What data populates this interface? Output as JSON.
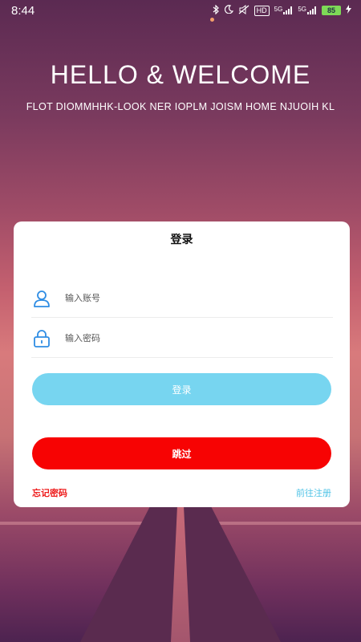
{
  "status_bar": {
    "time": "8:44",
    "hd": "HD",
    "net1": "5G",
    "net2": "5G",
    "battery": "85",
    "icons": [
      "bluetooth-icon",
      "moon-icon",
      "mute-icon",
      "hd-icon",
      "signal-icon",
      "signal-icon",
      "battery-icon",
      "charging-icon"
    ]
  },
  "header": {
    "title": "HELLO & WELCOME",
    "subtitle": "FLOT DIOMMHHK-LOOK NER IOPLM JOISM HOME NJUOIH KL"
  },
  "login_card": {
    "title": "登录",
    "account_placeholder": "输入账号",
    "password_placeholder": "输入密码",
    "login_button": "登录",
    "skip_button": "跳过",
    "forgot_password": "忘记密码",
    "register_link": "前往注册"
  },
  "colors": {
    "login_button": "#77d5f0",
    "skip_button": "#f70303",
    "forgot_link": "#ee1c1c",
    "register_link": "#4fc3e6",
    "input_icon": "#2f8de4"
  }
}
